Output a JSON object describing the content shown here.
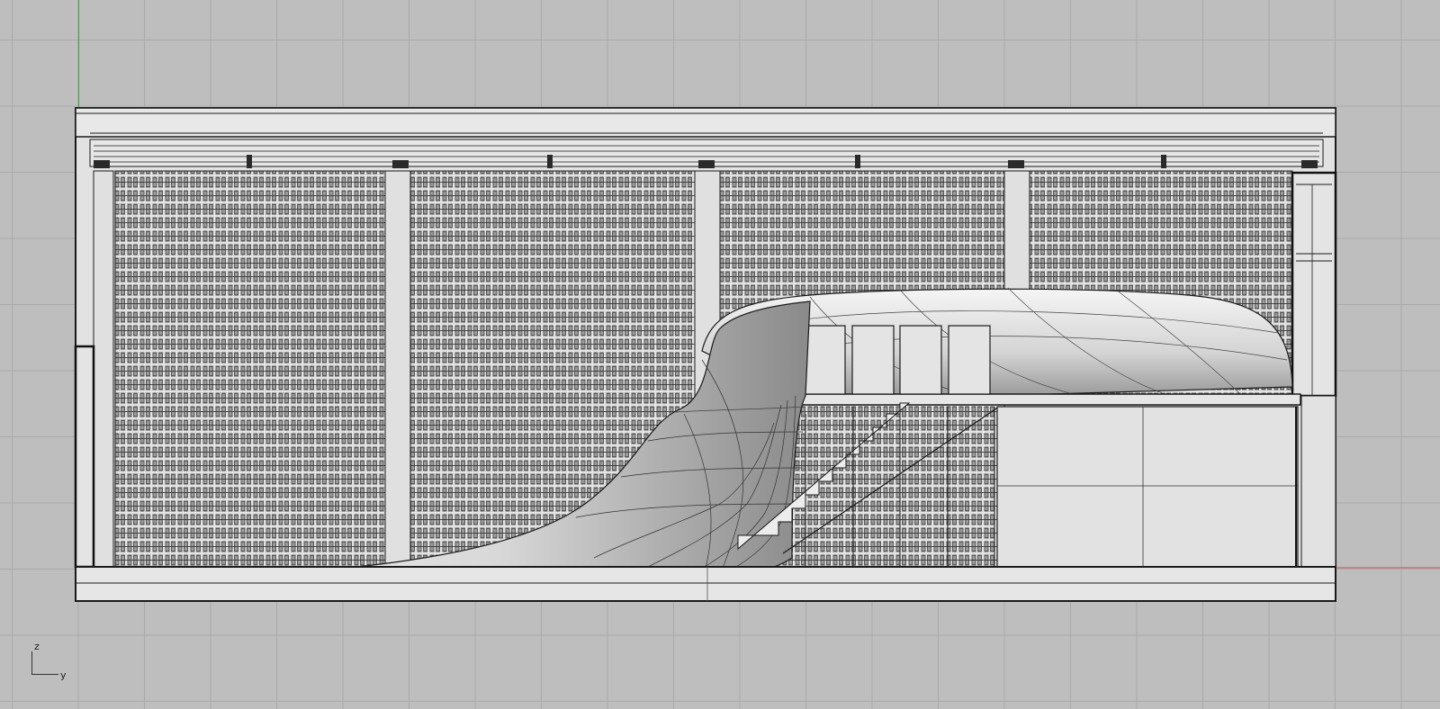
{
  "viewport": {
    "view": "Front",
    "grid": "on",
    "background_color": "#bebebe",
    "grid_color": "#a9a9a9",
    "x_axis_color": "#c85050",
    "z_axis_color": "#3fa03f"
  },
  "model": {
    "description_color": "#1a1a1a",
    "fill_color": "#e0e0e0",
    "shelf_panels": 4,
    "stair_steps": 9,
    "display_boxes": 4
  },
  "axis_gizmo": {
    "vertical_label": "z",
    "horizontal_label": "y"
  }
}
